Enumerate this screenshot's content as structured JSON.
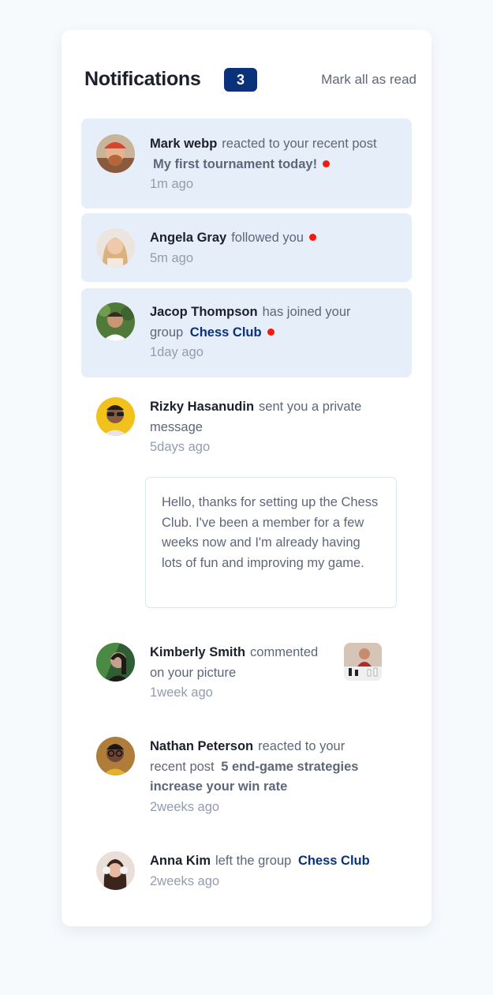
{
  "header": {
    "title": "Notifications",
    "unread_count": "3",
    "mark_all_label": "Mark all as read"
  },
  "notifications": [
    {
      "name": "Mark webp",
      "action": "reacted to your recent post",
      "target": "My first tournament today!",
      "time": "1m ago",
      "unread": true
    },
    {
      "name": "Angela Gray",
      "action": "followed you",
      "time": "5m ago",
      "unread": true
    },
    {
      "name": "Jacop Thompson",
      "action": "has joined your group",
      "group": "Chess Club",
      "time": "1day ago",
      "unread": true
    },
    {
      "name": "Rizky Hasanudin",
      "action": "sent you a private message",
      "time": "5days ago",
      "message": "Hello, thanks for setting up the Chess Club. I've been a member for a few weeks now and I'm already having lots of fun and improving my game.",
      "unread": false
    },
    {
      "name": "Kimberly Smith",
      "action": "commented on your picture",
      "time": "1week ago",
      "unread": false
    },
    {
      "name": "Nathan Peterson",
      "action": "reacted to your recent post",
      "target": "5 end-game strategies increase your win rate",
      "time": "2weeks ago",
      "unread": false
    },
    {
      "name": "Anna Kim",
      "action": "left the group",
      "group": "Chess Club",
      "time": "2weeks ago",
      "unread": false
    }
  ],
  "colors": {
    "accent": "#0a327b",
    "unread_bg": "#e6eef9",
    "dot": "#f6190d",
    "heading": "#1c202b",
    "text": "#5e6778",
    "muted": "#939cad"
  }
}
